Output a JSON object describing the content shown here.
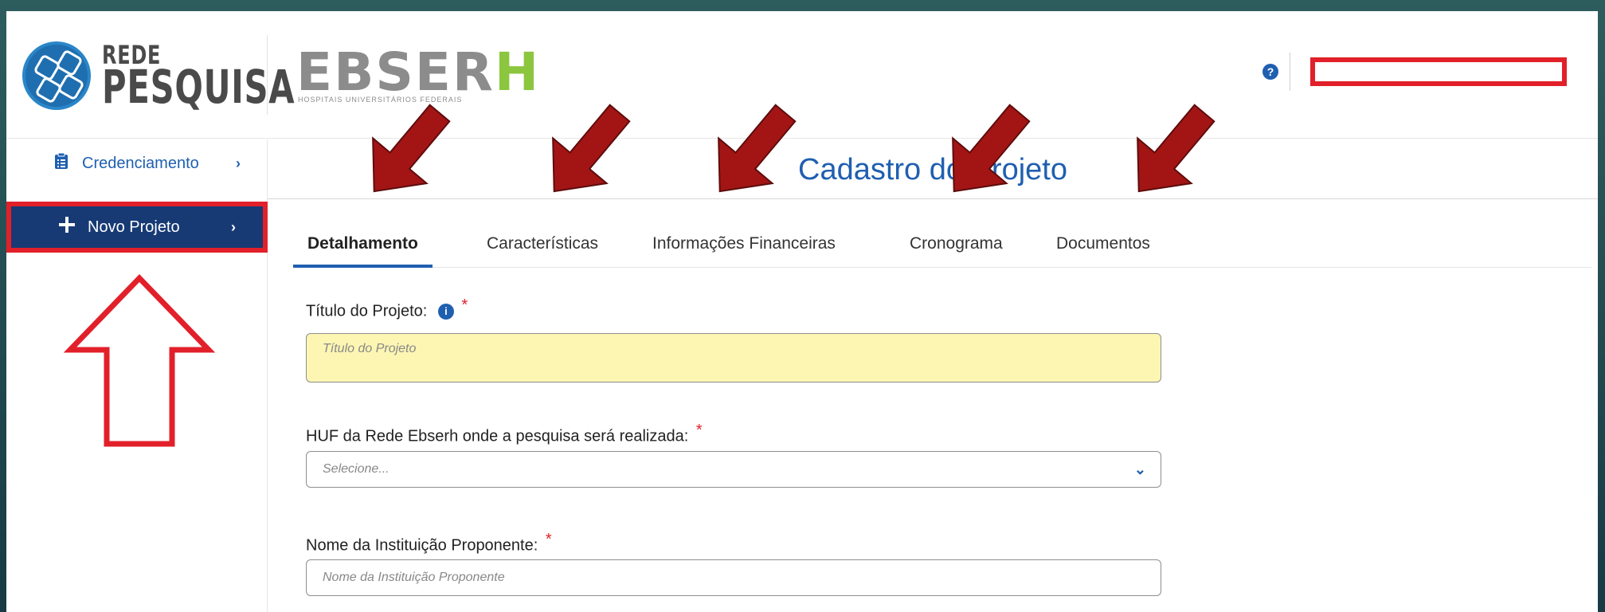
{
  "header": {
    "rede_logo_line1": "REDE",
    "rede_logo_line2": "PESQUISA",
    "ebserh_logo_main": "EBSER",
    "ebserh_logo_h": "H",
    "ebserh_logo_sub": "HOSPITAIS UNIVERSITÁRIOS FEDERAIS",
    "help_icon": "?"
  },
  "sidebar": {
    "items": [
      {
        "label": "Credenciamento",
        "icon": "clipboard-list-icon",
        "chevron": "›"
      },
      {
        "label": "Novo Projeto",
        "icon": "plus-icon",
        "chevron": "›"
      }
    ]
  },
  "main": {
    "title": "Cadastro do Projeto",
    "tabs": [
      {
        "label": "Detalhamento",
        "active": true
      },
      {
        "label": "Características",
        "active": false
      },
      {
        "label": "Informações Financeiras",
        "active": false
      },
      {
        "label": "Cronograma",
        "active": false
      },
      {
        "label": "Documentos",
        "active": false
      }
    ],
    "form": {
      "titulo_label": "Título do Projeto:",
      "titulo_placeholder": "Título do Projeto",
      "huf_label": "HUF da Rede Ebserh onde a pesquisa será realizada:",
      "huf_placeholder": "Selecione...",
      "instituicao_label": "Nome da Instituição Proponente:",
      "instituicao_placeholder": "Nome da Instituição Proponente",
      "required_mark": "*",
      "info_icon": "i"
    }
  },
  "colors": {
    "brand_blue": "#1f5fb0",
    "sidebar_active": "#173a75",
    "annotation_red": "#e2202a",
    "arrow_dark_red": "#a31515",
    "input_highlight": "#fdf6b3",
    "ebserh_green": "#8cc63f"
  }
}
